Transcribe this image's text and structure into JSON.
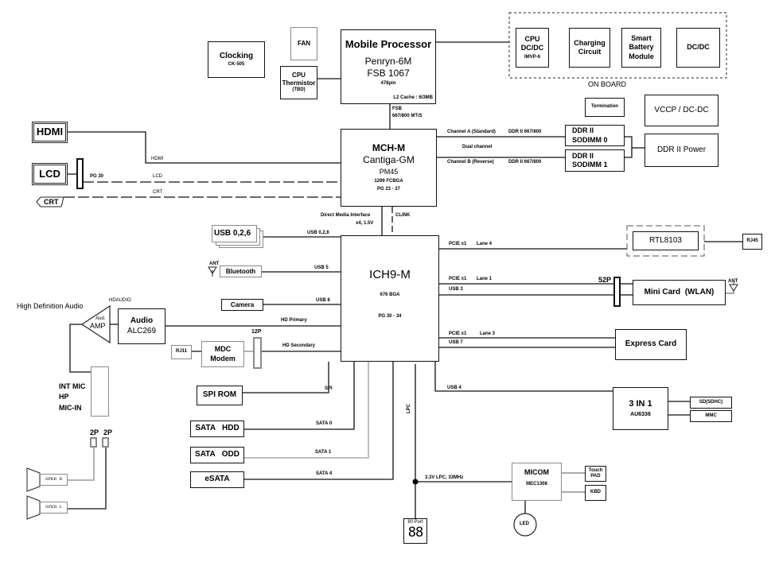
{
  "cpu": {
    "title": "Mobile Processor",
    "name": "Penryn-6M",
    "fsb": "FSB 1067",
    "pins": "478pin",
    "cache": "L2 Cache : 6/3MB"
  },
  "fan": "FAN",
  "clocking": {
    "title": "Clocking",
    "part": "CK-505"
  },
  "thermistor": {
    "line1": "CPU",
    "line2": "Thermistor",
    "line3": "(TBD)"
  },
  "onboard": {
    "label": "ON BOARD",
    "cpu_dcdc": {
      "line1": "CPU",
      "line2": "DC/DC",
      "line3": "IMVP-6"
    },
    "charging": {
      "line1": "Charging",
      "line2": "Circuit"
    },
    "battery": {
      "line1": "Smart",
      "line2": "Battery",
      "line3": "Module"
    },
    "dcdc": "DC/DC"
  },
  "fsb_label": {
    "line1": "FSB",
    "line2": "667/800 MT/S"
  },
  "termination": "Termination",
  "vccp": "VCCP / DC-DC",
  "mch": {
    "title": "MCH-M",
    "name": "Cantiga-GM",
    "model": "PM45",
    "pkg": "1299 FCBGA",
    "pg": "PG 23 - 27"
  },
  "memory": {
    "ch_a": "Channel A (Standard)",
    "ch_a_speed": "DDR II 667/800",
    "dual": "Dual channel",
    "ch_b": "Channel B (Reverse)",
    "ch_b_speed": "DDR II 667/800",
    "sodimm0": {
      "line1": "DDR II",
      "line2": "SODIMM 0"
    },
    "sodimm1": {
      "line1": "DDR II",
      "line2": "SODIMM 1"
    },
    "power": "DDR II Power"
  },
  "display": {
    "hdmi": "HDMI",
    "lcd": "LCD",
    "crt": "CRT",
    "pg30": "PG 30",
    "hdmi_sig": "HDMI",
    "lcd_sig": "LCD",
    "crt_sig": "CRT"
  },
  "dmi": {
    "line1": "Direct Media Interface",
    "line2": "x4, 1.5V",
    "clink": "CLINK"
  },
  "ich": {
    "title": "ICH9-M",
    "pkg": "676 BGA",
    "pg": "PG 30 - 34"
  },
  "usb026": {
    "label": "USB 0,2,6",
    "sig": "USB 0,2,6"
  },
  "bluetooth": {
    "label": "Bluetooth",
    "ant": "ANT",
    "sig": "USB 5"
  },
  "camera": {
    "label": "Camera",
    "sig": "USB 8"
  },
  "audio": {
    "section": "High Definition Audio",
    "hdaudio": "HDAUDIO",
    "amp_small": "Aud.",
    "amp": "AMP",
    "codec1": "Audio",
    "codec2": "ALC269",
    "hd_primary": "HD Primary",
    "hd_secondary": "HD Secondary",
    "jacks": [
      "INT MIC",
      "HP",
      "MIC-IN"
    ],
    "spk_conn": [
      "2P",
      "2P"
    ],
    "spk_r": "SPKR  R",
    "spk_l": "SPKR  L"
  },
  "modem": {
    "rj11": "RJ11",
    "line1": "MDC",
    "line2": "Modem",
    "conn": "12P"
  },
  "spi": {
    "label": "SPI ROM",
    "sig": "SPI"
  },
  "sata": [
    {
      "label": "SATA   HDD",
      "sig": "SATA 0"
    },
    {
      "label": "SATA   ODD",
      "sig": "SATA 1"
    },
    {
      "label": "eSATA",
      "sig": "SATA 4"
    }
  ],
  "lpc": {
    "vlabel": "LPC",
    "bus": "3.3V LPC, 33MHz",
    "port80": "80 Port",
    "port80_digits": "88"
  },
  "micom": {
    "title": "MICOM",
    "part": "MEC1308",
    "touchpad1": "Touch",
    "touchpad2": "PAD",
    "kbd": "KBD",
    "led": "LED"
  },
  "lan": {
    "sig1": "PCIE x1",
    "sig2": "Lane 4",
    "chip": "RTL8103",
    "rj45": "RJ45"
  },
  "wlan": {
    "sig1": "PCIE x1",
    "sig2": "Lane 1",
    "sig3": "USB 3",
    "conn": "52P",
    "label": "Mini Card  (WLAN)",
    "ant": "ANT"
  },
  "express": {
    "sig1": "PCIE x1",
    "sig2": "Lane 3",
    "sig3": "USB 7",
    "label": "Express Card"
  },
  "cardreader": {
    "sig": "USB 4",
    "line1": "3 IN 1",
    "line2": "AU6336",
    "sd": "SD(SDHC)",
    "mmc": "MMC"
  }
}
